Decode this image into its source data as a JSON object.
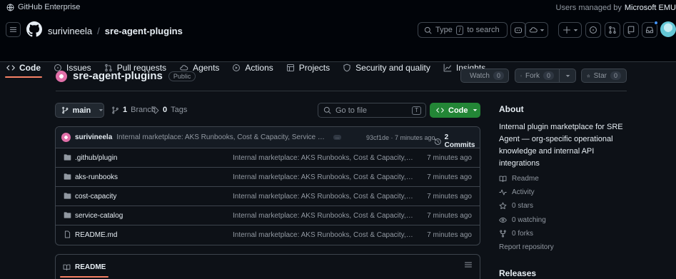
{
  "banner": {
    "title": "GitHub Enterprise",
    "managed_label": "Users managed by",
    "managed_org": "Microsoft EMU"
  },
  "header": {
    "owner": "surivineela",
    "separator": "/",
    "repo": "sre-agent-plugins",
    "search_text": "Type",
    "search_key": "/",
    "search_suffix": "to search"
  },
  "nav": {
    "tabs": [
      {
        "label": "Code",
        "icon": "code-icon",
        "active": true
      },
      {
        "label": "Issues",
        "icon": "issue-icon"
      },
      {
        "label": "Pull requests",
        "icon": "pull-request-icon"
      },
      {
        "label": "Agents",
        "icon": "agent-icon"
      },
      {
        "label": "Actions",
        "icon": "play-icon"
      },
      {
        "label": "Projects",
        "icon": "table-icon"
      },
      {
        "label": "Security and quality",
        "icon": "shield-icon"
      },
      {
        "label": "Insights",
        "icon": "graph-icon"
      }
    ]
  },
  "repo": {
    "name": "sre-agent-plugins",
    "visibility": "Public",
    "watch": {
      "label": "Watch",
      "count": "0"
    },
    "fork": {
      "label": "Fork",
      "count": "0"
    },
    "star": {
      "label": "Star",
      "count": "0"
    }
  },
  "toolbar": {
    "branch": "main",
    "branch_count": "1",
    "branch_label": "Branch",
    "tag_count": "0",
    "tag_label": "Tags",
    "goto_placeholder": "Go to file",
    "goto_key": "T",
    "code_label": "Code"
  },
  "commit": {
    "author": "surivineela",
    "message": "Internal marketplace: AKS Runbooks, Cost & Capacity, Service Catalog plugins",
    "ellipsis": "...",
    "hash_time": "93cf1de · 7 minutes ago",
    "commits_label": "2 Commits"
  },
  "files": [
    {
      "name": ".github/plugin",
      "type": "folder",
      "message": "Internal marketplace: AKS Runbooks, Cost & Capacity, Service Catalog plugins",
      "time": "7 minutes ago"
    },
    {
      "name": "aks-runbooks",
      "type": "folder",
      "message": "Internal marketplace: AKS Runbooks, Cost & Capacity, Service Catalog plugins",
      "time": "7 minutes ago"
    },
    {
      "name": "cost-capacity",
      "type": "folder",
      "message": "Internal marketplace: AKS Runbooks, Cost & Capacity, Service Catalog plugins",
      "time": "7 minutes ago"
    },
    {
      "name": "service-catalog",
      "type": "folder",
      "message": "Internal marketplace: AKS Runbooks, Cost & Capacity, Service Catalog plugins",
      "time": "7 minutes ago"
    },
    {
      "name": "README.md",
      "type": "file",
      "message": "Internal marketplace: AKS Runbooks, Cost & Capacity, Service Catalog plugins",
      "time": "7 minutes ago"
    }
  ],
  "readme": {
    "tab_label": "README"
  },
  "about": {
    "heading": "About",
    "description": "Internal plugin marketplace for SRE Agent — org-specific operational knowledge and internal API integrations",
    "items": [
      {
        "label": "Readme",
        "icon": "book-icon"
      },
      {
        "label": "Activity",
        "icon": "pulse-icon"
      },
      {
        "label": "0 stars",
        "icon": "star-icon"
      },
      {
        "label": "0 watching",
        "icon": "eye-icon"
      },
      {
        "label": "0 forks",
        "icon": "fork-icon"
      }
    ],
    "report": "Report repository",
    "releases": "Releases"
  },
  "colors": {
    "background": "#0d1117",
    "header": "#010409",
    "accent_tab": "#f78166",
    "code_button": "#238636",
    "notification_dot": "#4493f8"
  }
}
